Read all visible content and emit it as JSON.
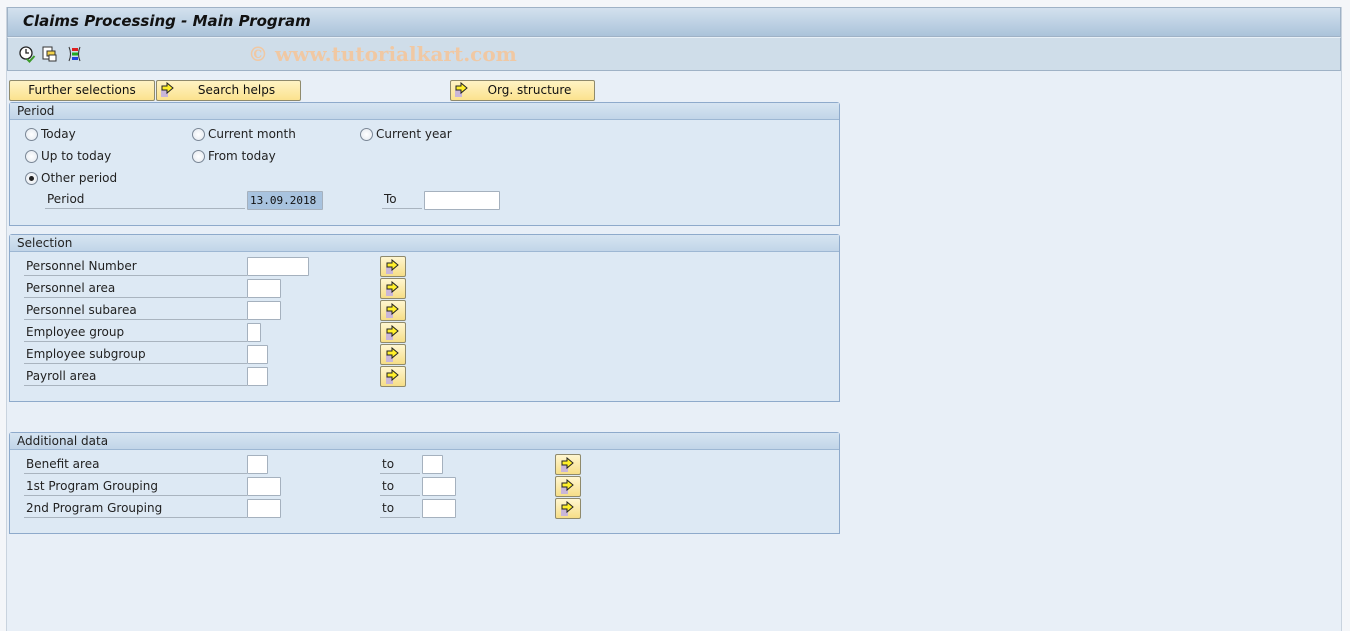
{
  "window": {
    "title": "Claims Processing - Main Program",
    "watermark": "© www.tutorialkart.com"
  },
  "toolbar": {
    "icons": [
      "execute-clock-icon",
      "get-variant-icon",
      "selection-options-icon"
    ]
  },
  "buttons": {
    "further_selections": "Further selections",
    "search_helps": "Search helps",
    "org_structure": "Org. structure"
  },
  "period": {
    "heading": "Period",
    "options": [
      {
        "label": "Today",
        "selected": false
      },
      {
        "label": "Current month",
        "selected": false
      },
      {
        "label": "Current year",
        "selected": false
      },
      {
        "label": "Up to today",
        "selected": false
      },
      {
        "label": "From today",
        "selected": false
      },
      {
        "label": "Other period",
        "selected": true
      }
    ],
    "period_label": "Period",
    "period_from": "13.09.2018",
    "to_label": "To",
    "period_to": ""
  },
  "selection": {
    "heading": "Selection",
    "rows": [
      {
        "label": "Personnel Number",
        "value": ""
      },
      {
        "label": "Personnel area",
        "value": ""
      },
      {
        "label": "Personnel subarea",
        "value": ""
      },
      {
        "label": "Employee group",
        "value": ""
      },
      {
        "label": "Employee subgroup",
        "value": ""
      },
      {
        "label": "Payroll area",
        "value": ""
      }
    ]
  },
  "additional": {
    "heading": "Additional data",
    "rows": [
      {
        "label": "Benefit area",
        "from": "",
        "to_label": "to",
        "to": ""
      },
      {
        "label": "1st Program Grouping",
        "from": "",
        "to_label": "to",
        "to": ""
      },
      {
        "label": "2nd Program Grouping",
        "from": "",
        "to_label": "to",
        "to": ""
      }
    ]
  }
}
